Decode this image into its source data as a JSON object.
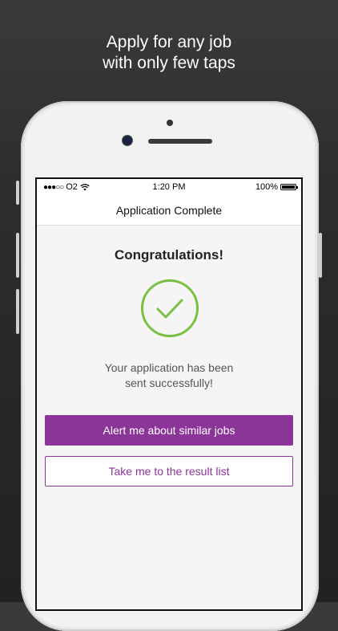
{
  "promo": {
    "line1": "Apply for any job",
    "line2": "with only few taps"
  },
  "status_bar": {
    "signal_dots": "●●●○○",
    "carrier": "O2",
    "wifi_icon": "wifi-icon",
    "time": "1:20 PM",
    "battery": "100%",
    "battery_icon": "battery-icon"
  },
  "nav": {
    "title": "Application Complete"
  },
  "main": {
    "heading": "Congratulations!",
    "check_icon": "checkmark-circle-icon",
    "message_line1": "Your application has been",
    "message_line2": "sent successfully!",
    "primary_button": "Alert me about similar jobs",
    "secondary_button": "Take me to the result list"
  },
  "colors": {
    "accent": "#8a3597",
    "success": "#7ac143",
    "background_dark": "#2c2c2c"
  }
}
